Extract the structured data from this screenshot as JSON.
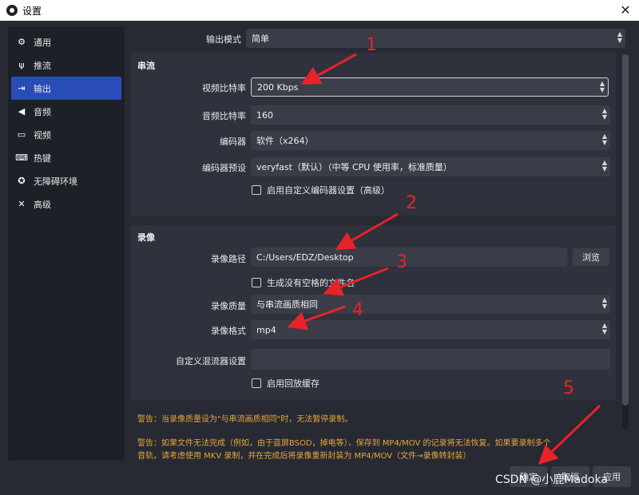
{
  "window": {
    "title": "设置",
    "close_glyph": "✕"
  },
  "sidebar": {
    "items": [
      {
        "label": "通用",
        "icon": "gear-icon",
        "glyph": "⚙"
      },
      {
        "label": "推流",
        "icon": "antenna-icon",
        "glyph": "ψ"
      },
      {
        "label": "输出",
        "icon": "output-icon",
        "glyph": "⇥"
      },
      {
        "label": "音频",
        "icon": "speaker-icon",
        "glyph": "◀"
      },
      {
        "label": "视频",
        "icon": "monitor-icon",
        "glyph": "▭"
      },
      {
        "label": "热键",
        "icon": "keyboard-icon",
        "glyph": "⌨"
      },
      {
        "label": "无障碍环境",
        "icon": "accessibility-icon",
        "glyph": "✪"
      },
      {
        "label": "高级",
        "icon": "tools-icon",
        "glyph": "✕"
      }
    ],
    "active_index": 2
  },
  "output_mode": {
    "label": "输出模式",
    "value": "简单"
  },
  "streaming": {
    "title": "串流",
    "video_bitrate": {
      "label": "视频比特率",
      "value": "200 Kbps"
    },
    "audio_bitrate": {
      "label": "音频比特率",
      "value": "160"
    },
    "encoder": {
      "label": "编码器",
      "value": "软件（x264）"
    },
    "encoder_preset": {
      "label": "编码器预设",
      "value": "veryfast（默认）（中等 CPU 使用率，标准质量）"
    },
    "custom_encoder": {
      "label": "启用自定义编码器设置（高级）"
    }
  },
  "recording": {
    "title": "录像",
    "path": {
      "label": "录像路径",
      "value": "C:/Users/EDZ/Desktop",
      "browse": "浏览"
    },
    "no_space": {
      "label": "生成没有空格的文件名"
    },
    "quality": {
      "label": "录像质量",
      "value": "与串流画质相同"
    },
    "format": {
      "label": "录像格式",
      "value": "mp4"
    },
    "muxer": {
      "label": "自定义混流器设置",
      "value": ""
    },
    "replay_buffer": {
      "label": "启用回放缓存"
    }
  },
  "warnings": {
    "line1": "警告：当录像质量设为\"与串流画质相同\"时，无法暂停录制。",
    "line2a": "警告：如果文件无法完成（例如，由于蓝屏BSOD，掉电等），保存到 MP4/MOV 的记录将无法恢复。如果要录制多个",
    "line2b": "音轨，请考虑使用 MKV 录制，并在完成后将录像重新封装为 MP4/MOV（文件→录像转封装）"
  },
  "footer": {
    "ok": "确定",
    "cancel": "取消",
    "apply": "应用"
  },
  "watermark": "CSDN @小鹿Madoka",
  "annotations": {
    "color": "#e8222a",
    "numbers": [
      "1",
      "2",
      "3",
      "4",
      "5"
    ]
  },
  "colors": {
    "accent": "#284cb8",
    "warning": "#e5a63a",
    "panel": "#2f323c",
    "background": "#272a33"
  }
}
